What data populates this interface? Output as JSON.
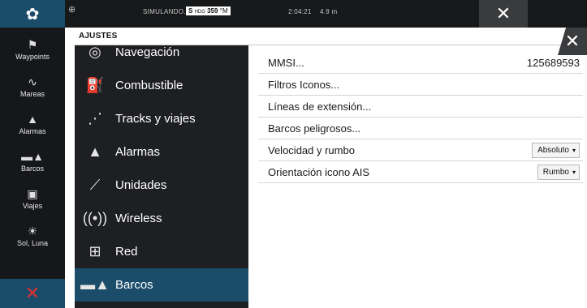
{
  "statusbar": {
    "simulating": "SIMULANDO...",
    "hdg_label": "S",
    "hdg_small": "HDG",
    "hdg_value": "359",
    "hdg_unit": "°M",
    "time": "2:04:21",
    "distance": "4.9 m"
  },
  "sidebar": {
    "items": [
      {
        "label": "Waypoints",
        "icon": "flag-icon"
      },
      {
        "label": "Mareas",
        "icon": "wave-icon"
      },
      {
        "label": "Alarmas",
        "icon": "bell-icon"
      },
      {
        "label": "Barcos",
        "icon": "ship-icon"
      },
      {
        "label": "Viajes",
        "icon": "trip-icon"
      },
      {
        "label": "Sol, Luna",
        "icon": "sun-moon-icon"
      }
    ]
  },
  "panel": {
    "title": "AJUSTES"
  },
  "menu": {
    "items": [
      {
        "label": "Navegación",
        "icon": "compass-icon"
      },
      {
        "label": "Combustible",
        "icon": "fuel-icon"
      },
      {
        "label": "Tracks y viajes",
        "icon": "track-icon"
      },
      {
        "label": "Alarmas",
        "icon": "bell-icon"
      },
      {
        "label": "Unidades",
        "icon": "ruler-icon"
      },
      {
        "label": "Wireless",
        "icon": "wireless-icon"
      },
      {
        "label": "Red",
        "icon": "network-icon"
      },
      {
        "label": "Barcos",
        "icon": "ship-icon",
        "selected": true
      }
    ]
  },
  "settings": {
    "mmsi_label": "MMSI...",
    "mmsi_value": "125689593",
    "filtros_label": "Filtros Iconos...",
    "lineas_label": "Líneas de extensión...",
    "peligrosos_label": "Barcos peligrosos...",
    "velocidad_label": "Velocidad y rumbo",
    "velocidad_value": "Absoluto",
    "orientacion_label": "Orientación icono AIS",
    "orientacion_value": "Rumbo"
  },
  "colors": {
    "accent": "#1b4d6b",
    "sidebar_bg": "#16171a",
    "menu_bg": "#1e1f22",
    "alert_red": "#e03030"
  }
}
